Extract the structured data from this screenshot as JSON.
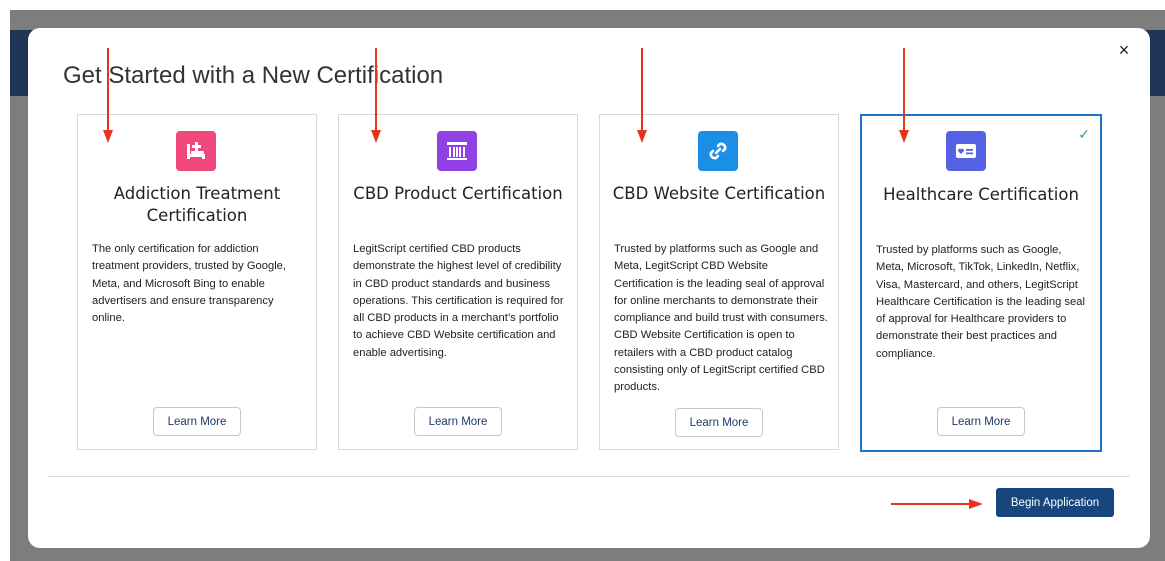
{
  "modal": {
    "title": "Get Started with a New Certification",
    "close_label": "×",
    "begin_label": "Begin Application"
  },
  "cards": [
    {
      "title": "Addiction Treatment Certification",
      "description": "The only certification for addiction treatment providers, trusted by Google, Meta, and Microsoft Bing to enable advertisers and ensure transparency online.",
      "button": "Learn More",
      "icon": "bed-icon",
      "icon_color": "#f0477c",
      "selected": false
    },
    {
      "title": "CBD Product Certification",
      "description": "LegitScript certified CBD products demonstrate the highest level of credibility in CBD product standards and business operations. This certification is required for all CBD products in a merchant’s portfolio to achieve CBD Website certification and enable advertising.",
      "button": "Learn More",
      "icon": "columns-icon",
      "icon_color": "#9140e6",
      "selected": false
    },
    {
      "title": "CBD Website Certification",
      "description": "Trusted by platforms such as Google and Meta, LegitScript CBD Website Certification is the leading seal of approval for online merchants to demonstrate their compliance and build trust with consumers. CBD Website Certification is open to retailers with a CBD product catalog consisting only of LegitScript certified CBD products.",
      "button": "Learn More",
      "icon": "link-icon",
      "icon_color": "#1b8fe8",
      "selected": false
    },
    {
      "title": "Healthcare Certification",
      "description": "Trusted by platforms such as Google, Meta, Microsoft, TikTok, LinkedIn, Netflix, Visa, Mastercard, and others, LegitScript Healthcare Certification is the leading seal of approval for Healthcare providers to demonstrate their best practices and compliance.",
      "button": "Learn More",
      "icon": "id-card-heart-icon",
      "icon_color": "#5562e6",
      "selected": true,
      "check": "✓"
    }
  ],
  "colors": {
    "backdrop": "#7d7d7d",
    "header": "#1e3557",
    "primary_button": "#17457e",
    "selected_border": "#1b75c8",
    "annotation_arrow": "#e8321e",
    "check": "#3aa655"
  }
}
